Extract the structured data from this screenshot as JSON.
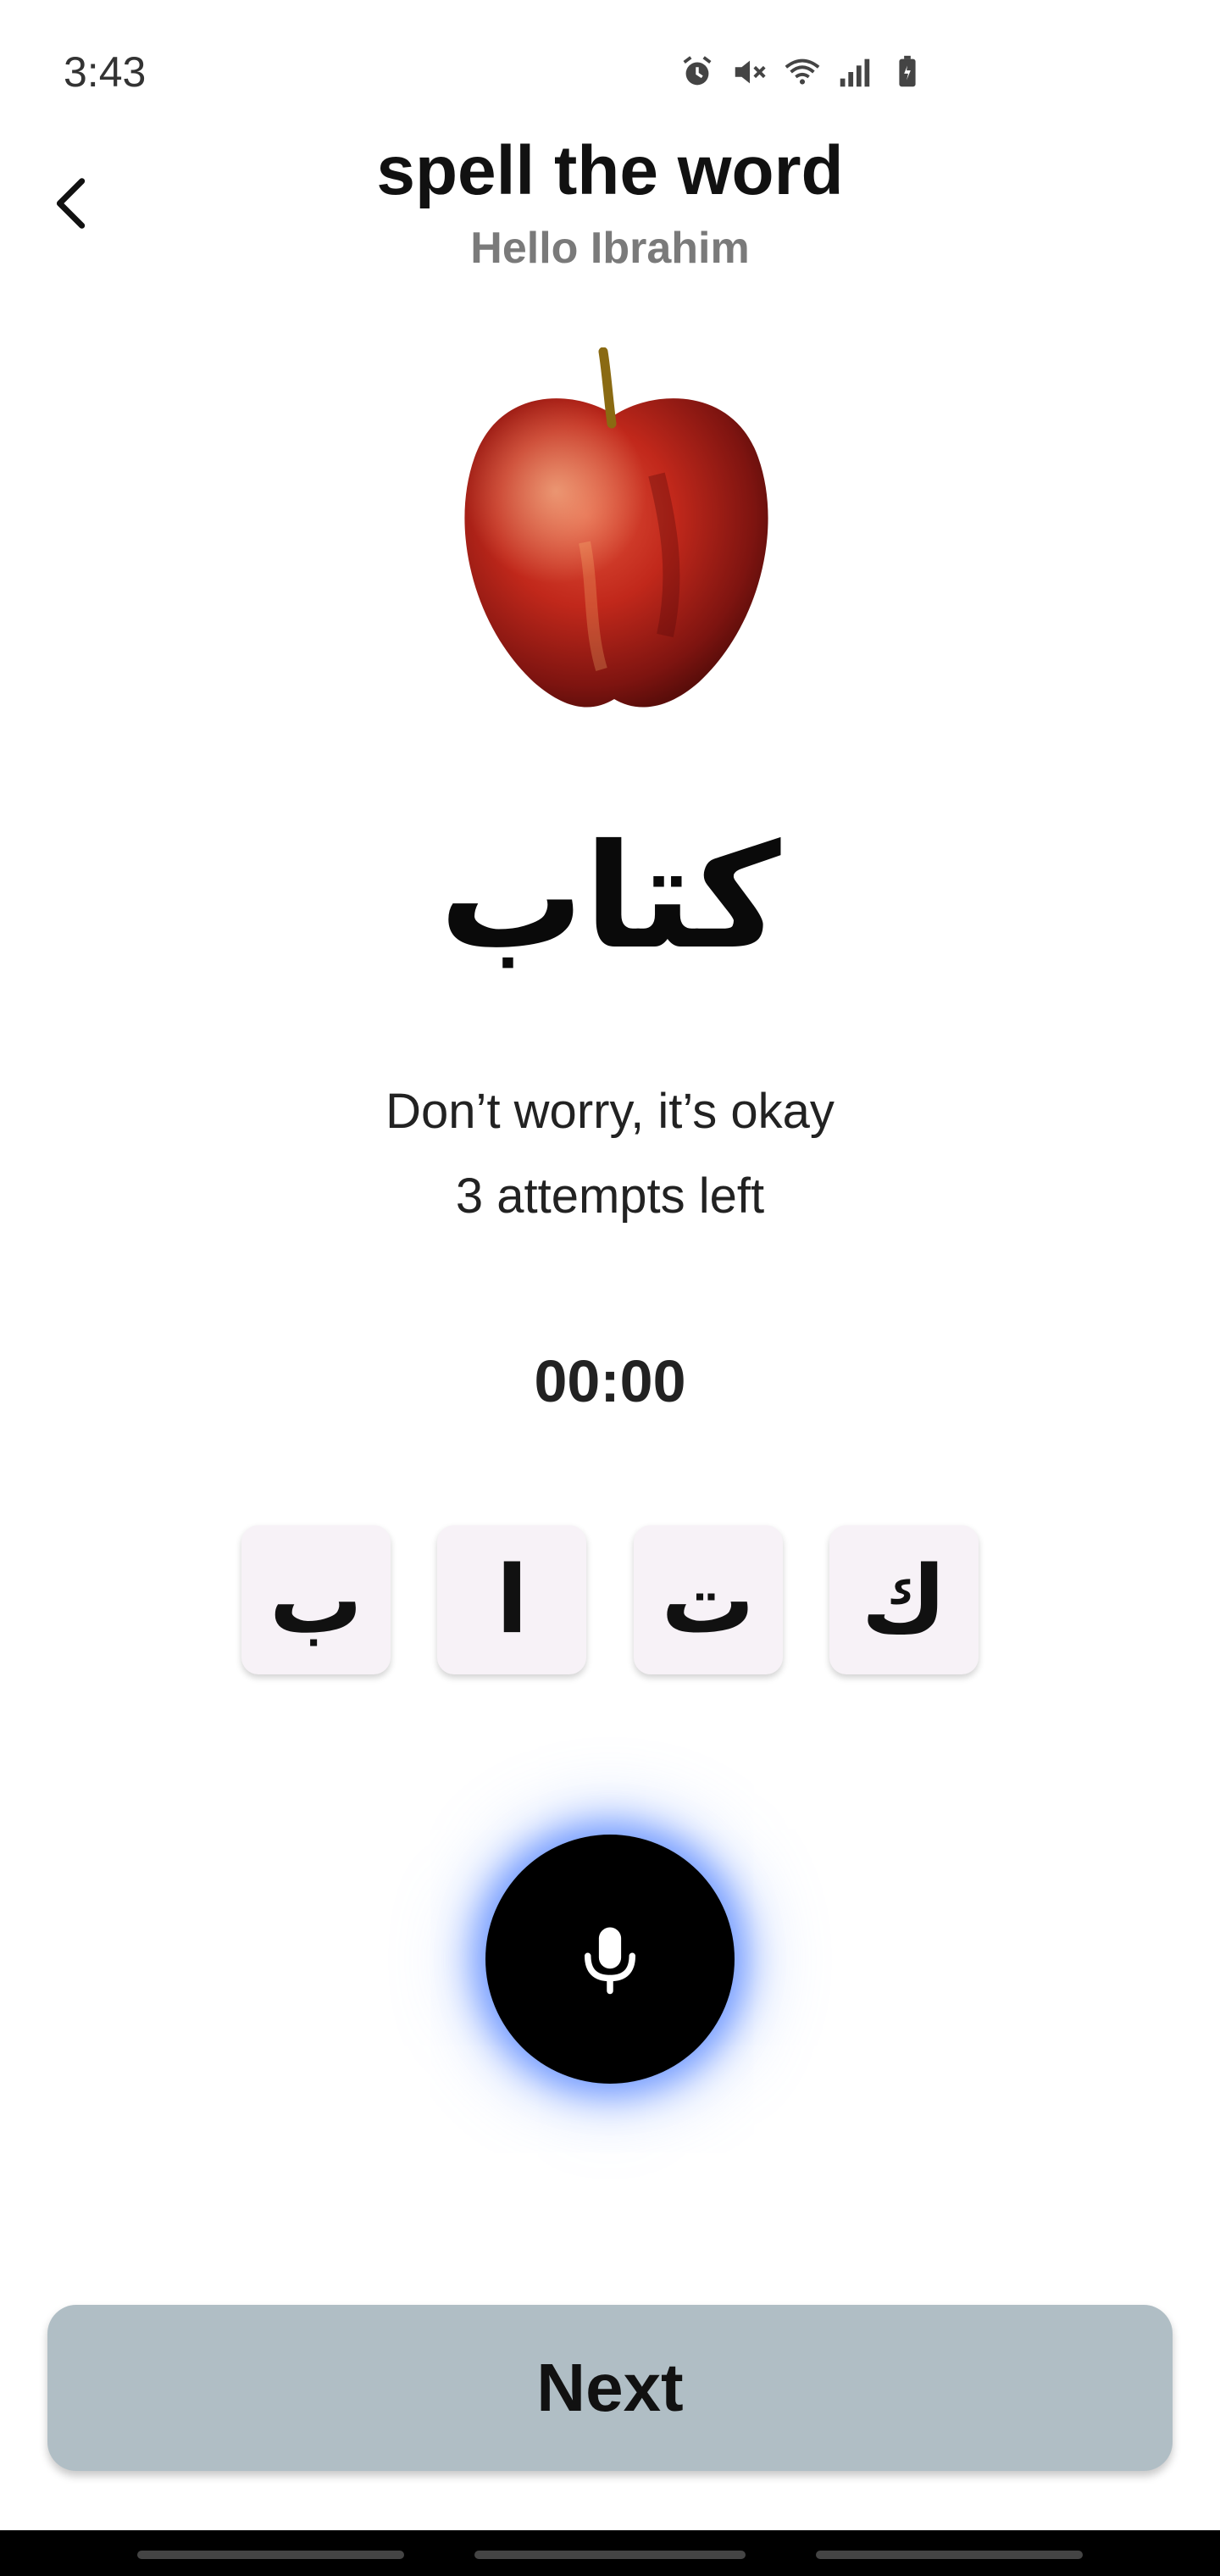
{
  "status_bar": {
    "time": "3:43",
    "icons": [
      "alarm-icon",
      "mute-icon",
      "wifi-icon",
      "signal-icon",
      "battery-icon"
    ]
  },
  "header": {
    "title": "spell the word",
    "subtitle": "Hello Ibrahim",
    "back_icon": "chevron-left-icon"
  },
  "word": {
    "image_subject": "red apple",
    "arabic": "كتاب"
  },
  "feedback": {
    "message": "Don’t worry, it’s okay",
    "attempts": "3 attempts left"
  },
  "timer": "00:00",
  "letters": [
    "ب",
    "ا",
    "ت",
    "ك"
  ],
  "mic": {
    "icon": "microphone-icon",
    "glow_color": "#5082ff"
  },
  "next_button": {
    "label": "Next",
    "color": "#b0bec5"
  }
}
